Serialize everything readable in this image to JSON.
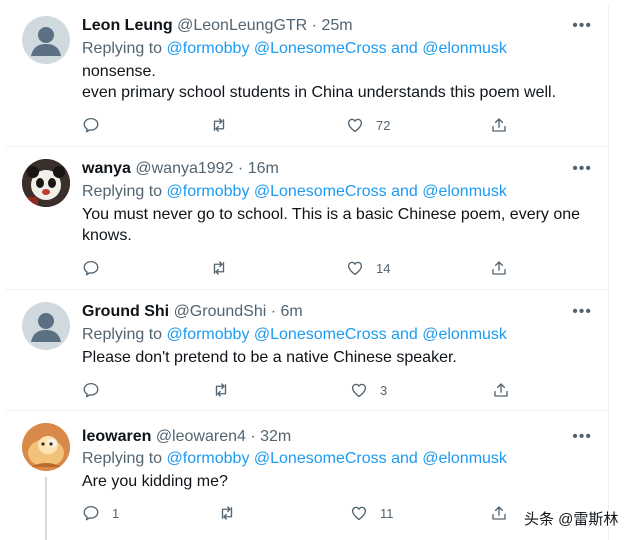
{
  "tweets": [
    {
      "name": "Leon Leung",
      "handle": "@LeonLeungGTR",
      "dot": "·",
      "time": "25m",
      "replying_label": "Replying to",
      "mentions": "@formobby @LonesomeCross and @elonmusk",
      "lines": [
        "nonsense.",
        "even primary school students in China understands this poem well."
      ],
      "replies": "",
      "retweets": "",
      "likes": "72"
    },
    {
      "name": "wanya",
      "handle": "@wanya1992",
      "dot": "·",
      "time": "16m",
      "replying_label": "Replying to",
      "mentions": "@formobby @LonesomeCross and @elonmusk",
      "lines": [
        "You must never go to school. This is a basic Chinese poem, every one",
        "knows."
      ],
      "replies": "",
      "retweets": "",
      "likes": "14"
    },
    {
      "name": "Ground Shi",
      "handle": "@GroundShi",
      "dot": "·",
      "time": "6m",
      "replying_label": "Replying to",
      "mentions": "@formobby @LonesomeCross and @elonmusk",
      "lines": [
        "Please don't pretend to be a native Chinese speaker."
      ],
      "replies": "",
      "retweets": "",
      "likes": "3"
    },
    {
      "name": "leowaren",
      "handle": "@leowaren4",
      "dot": "·",
      "time": "32m",
      "replying_label": "Replying to",
      "mentions": "@formobby @LonesomeCross and @elonmusk",
      "lines": [
        "Are you kidding me?"
      ],
      "replies": "1",
      "retweets": "",
      "likes": "11"
    }
  ],
  "more_glyph": "•••",
  "watermark": "头条 @雷斯林",
  "icons": [
    "reply-icon",
    "retweet-icon",
    "like-icon",
    "share-icon",
    "more-icon"
  ],
  "colors": {
    "link": "#1d9bf0",
    "muted": "#536471",
    "text": "#0f1419",
    "divider": "#eff3f4"
  }
}
